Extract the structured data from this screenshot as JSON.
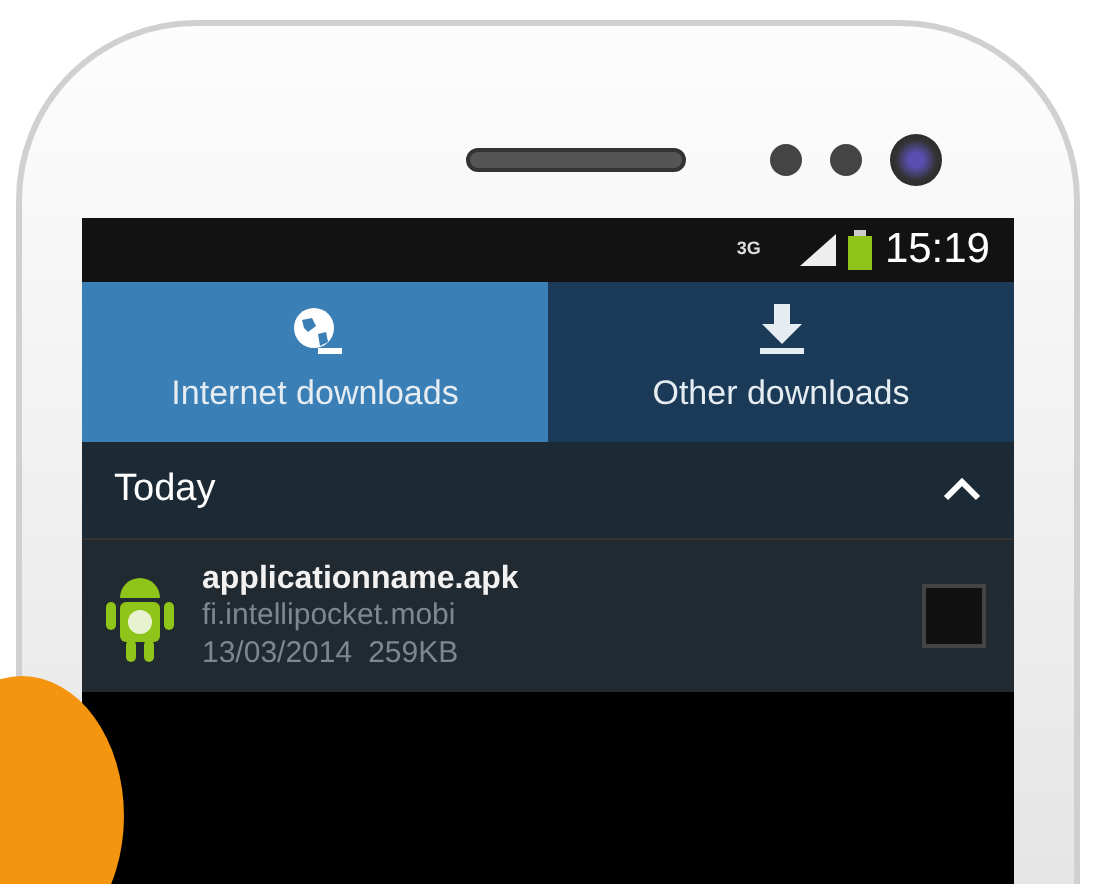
{
  "status_bar": {
    "network": "3G",
    "time": "15:19"
  },
  "tabs": [
    {
      "label": "Internet downloads",
      "selected": true,
      "kind": "globe"
    },
    {
      "label": "Other downloads",
      "selected": false,
      "kind": "download"
    }
  ],
  "section": {
    "title": "Today",
    "expanded": true
  },
  "downloads": [
    {
      "name": "applicationname.apk",
      "source": "fi.intellipocket.mobi",
      "date": "13/03/2014",
      "size": "259KB",
      "checked": false
    }
  ]
}
